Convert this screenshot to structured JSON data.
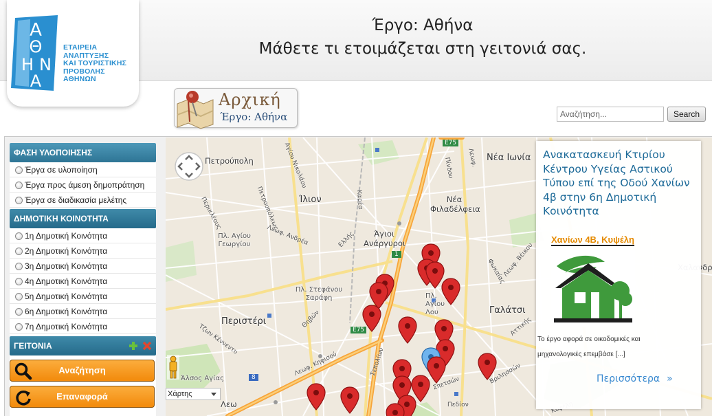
{
  "header": {
    "logo_letters": [
      "Α",
      "Θ",
      "Η",
      "Ν",
      "Α"
    ],
    "logo_text": [
      "ΕΤΑΙΡΕΙΑ",
      "ΑΝΑΠΤΥΞΗΣ",
      "ΚΑΙ ΤΟΥΡΙΣΤΙΚΗΣ",
      "ΠΡΟΒΟΛΗΣ",
      "ΑΘΗΝΩΝ"
    ],
    "title": "Έργο: Αθήνα",
    "subtitle": "Μάθετε τι ετοιμάζεται στη γειτονιά σας."
  },
  "home": {
    "label": "Αρχική",
    "sublabel": "Έργο: Αθήνα"
  },
  "search": {
    "placeholder": "Αναζήτηση...",
    "button": "Search"
  },
  "sidebar": {
    "phase": {
      "title": "ΦΑΣΗ ΥΛΟΠΟΙΗΣΗΣ",
      "items": [
        "Έργα σε υλοποίηση",
        "Έργα προς άμεση δημοπράτηση",
        "Έργα σε διαδικασία μελέτης"
      ]
    },
    "community": {
      "title": "ΔΗΜΟΤΙΚΗ ΚΟΙΝΟΤΗΤΑ",
      "items": [
        "1η Δημοτική Κοινότητα",
        "2η Δημοτική Κοινότητα",
        "3η Δημοτική Κοινότητα",
        "4η Δημοτική Κοινότητα",
        "5η Δημοτική Κοινότητα",
        "6η Δημοτική Κοινότητα",
        "7η Δημοτική Κοινότητα"
      ]
    },
    "neighborhood": {
      "title": "ΓΕΙΤΟΝΙΑ"
    },
    "search_button": "Αναζήτηση",
    "reset_button": "Επαναφορά"
  },
  "map": {
    "type_select": "Χάρτης",
    "labels": {
      "petroupoli": "Πετρούπολη",
      "nea_ionia": "Νέα Ιωνία",
      "ilion": "Ίλιον",
      "agioi_anargyroi": "Άγιοι Ανάργυροι",
      "nea_filadelfeia": "Νέα Φιλαδέλφεια",
      "pl_agiou_georgiou": "Πλ. Αγίου Γεωργίου",
      "pl_stefanou_sarafi": "Πλ. Στεφάνου Σαράφη",
      "peristeri": "Περιστέρι",
      "galatsi": "Γαλάτσι",
      "pl_agiou_louka": "Πλ. Αγίου Λου",
      "alsos_agias": "Άλσος Αγίας",
      "leo": "Λεω",
      "xalandri": "Χαλανδρι",
      "e75_a": "E75",
      "e75_b": "E75",
      "road_1": "1",
      "road_8": "8",
      "leof_kifisou": "Λεωφ. Κηφισού",
      "leof_kymis": "Λεωφ.",
      "leof_andrea": "Λεωφ. Ανδρέα",
      "petroupoleos": "Πετρουπόλεως",
      "agiou_nikolaou": "Αγίου Νικολάου",
      "pindou": "Πίνδου",
      "kareas": "Καρέα",
      "periklous": "Περικλέους",
      "ton_kennety": "Τζων Κέννεντυ",
      "thivon": "Θηβών",
      "ellis": "Ελλής",
      "sepolion": "Σεπολίων",
      "attikis": "Αττικής",
      "vrilission": "Βριλησσών",
      "fokaia": "Φωκαίας",
      "ag_veikou": "Λεωφ. Βέικου",
      "stratou": "Σπετσών",
      "pedion": "Πεδίον",
      "kipselis": "Κυψέλη"
    }
  },
  "info": {
    "title": "Ανακατασκευή Κτιρίου Κέντρου Υγείας Αστικού Τύπου επί της Οδού Χανίων 4β στην 6η Δημοτική Κοινότητα",
    "address": "Χανίων 4Β, Κυψέλη",
    "description_1": "Το έργο αφορά σε οικοδομικές και",
    "description_2": "μηχανολογικές επεμβάσε [...]",
    "more": "Περισσότερα",
    "more_chevron": "»"
  },
  "colors": {
    "sidebar_header": "#2e7595",
    "orange_button": "#f28a0b",
    "pin": "#d92b2b",
    "info_title": "#1d6a98",
    "address": "#e58a00"
  }
}
